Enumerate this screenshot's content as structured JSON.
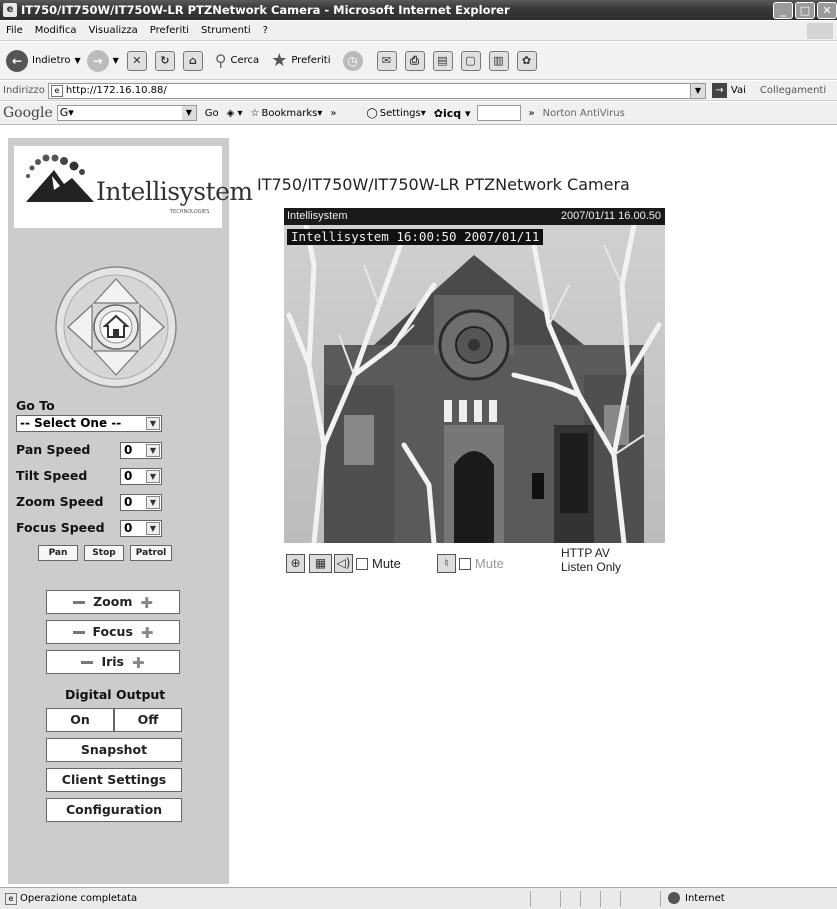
{
  "window": {
    "title": "IT750/IT750W/IT750W-LR PTZNetwork Camera - Microsoft Internet Explorer",
    "controls": {
      "minimize": "_",
      "maximize": "□",
      "close": "✕"
    }
  },
  "menu": [
    "File",
    "Modifica",
    "Visualizza",
    "Preferiti",
    "Strumenti",
    "?"
  ],
  "toolbar": {
    "back_label": "Indietro",
    "search_label": "Cerca",
    "favorites_label": "Preferiti"
  },
  "address": {
    "label": "Indirizzo",
    "url": "http://172.16.10.88/",
    "go_label": "Vai",
    "links_label": "Collegamenti"
  },
  "googlebar": {
    "logo": "Google",
    "search_value": "G▾",
    "go_label": "Go",
    "bookmarks_label": "Bookmarks▾",
    "settings_label": "Settings▾",
    "icq_label": "icq",
    "norton_label": "Norton AntiVirus"
  },
  "status": {
    "text": "Operazione completata",
    "zone": "Internet"
  },
  "sidebar": {
    "logo_text": "Intellisystem",
    "logo_sub": "TECHNOLOGIES",
    "goto_label": "Go To",
    "goto_value": "-- Select One --",
    "pan_speed_label": "Pan Speed",
    "pan_speed_value": "0",
    "tilt_speed_label": "Tilt Speed",
    "tilt_speed_value": "0",
    "zoom_speed_label": "Zoom Speed",
    "zoom_speed_value": "0",
    "focus_speed_label": "Focus Speed",
    "focus_speed_value": "0",
    "pan_button": "Pan",
    "stop_button": "Stop",
    "patrol_button": "Patrol",
    "zoom_label": "Zoom",
    "focus_label": "Focus",
    "iris_label": "Iris",
    "digital_output_label": "Digital Output",
    "on_button": "On",
    "off_button": "Off",
    "snapshot_button": "Snapshot",
    "client_settings_button": "Client Settings",
    "configuration_button": "Configuration"
  },
  "main": {
    "page_title": "IT750/IT750W/IT750W-LR PTZNetwork Camera",
    "cam_name": "Intellisystem",
    "cam_datetime": "2007/01/11 16.00.50",
    "overlay_text": "Intellisystem 16:00:50 2007/01/11",
    "mute_label": "Mute",
    "mute2_label": "Mute",
    "http_av": "HTTP  AV",
    "listen_only": "Listen Only"
  }
}
